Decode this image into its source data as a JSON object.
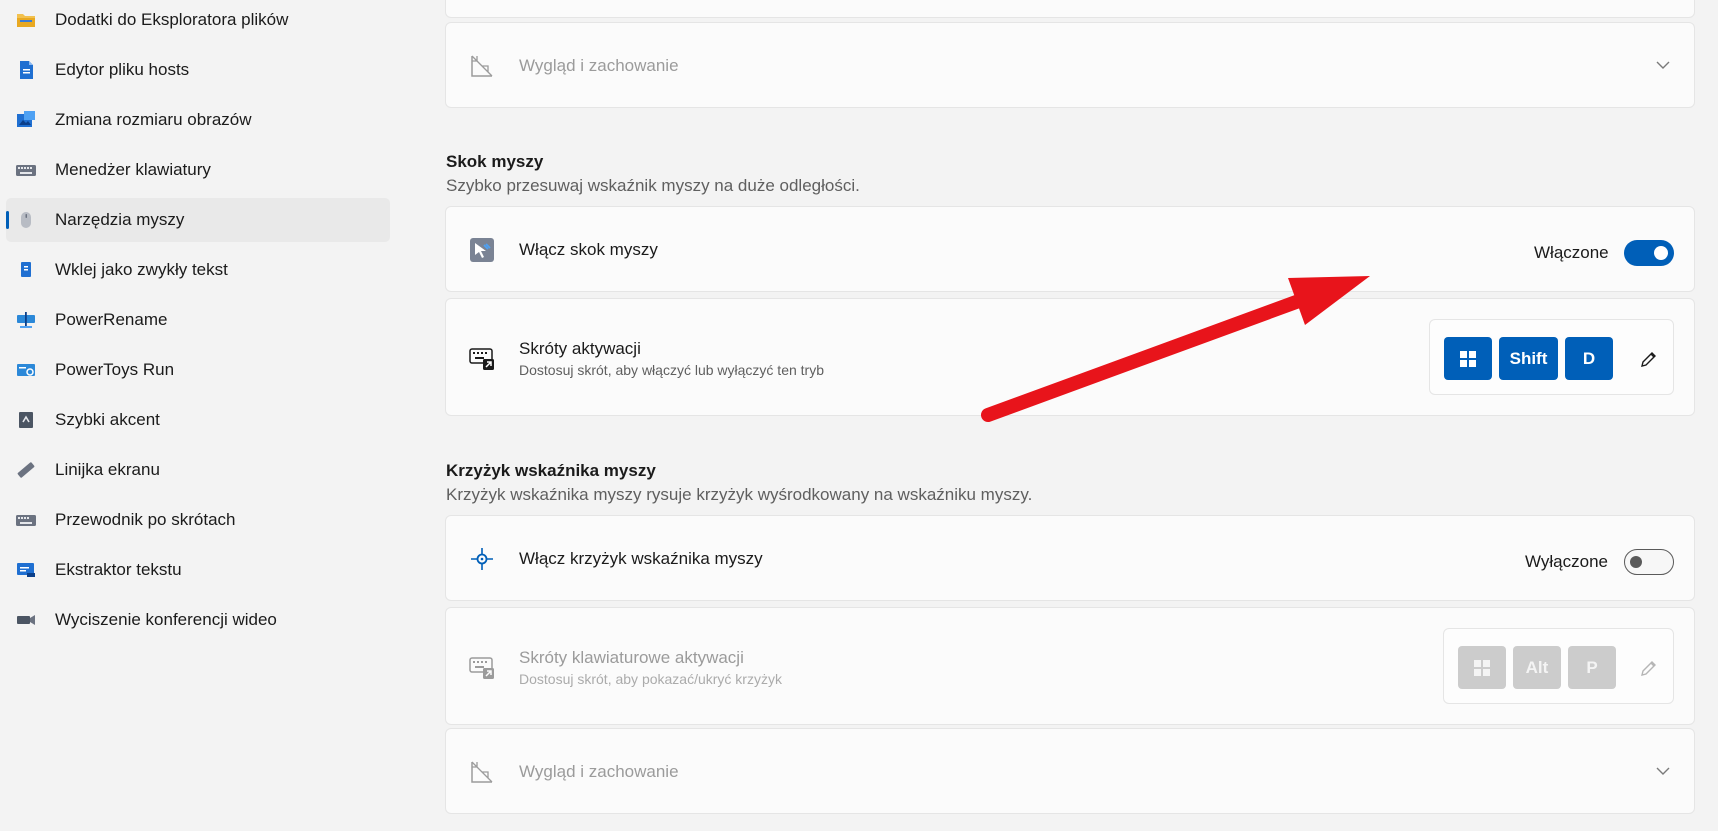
{
  "sidebar": {
    "items": [
      {
        "label": "Dodatki do Eksploratora plików",
        "icon": "folder-icon"
      },
      {
        "label": "Edytor pliku hosts",
        "icon": "document-icon"
      },
      {
        "label": "Zmiana rozmiaru obrazów",
        "icon": "image-resize-icon"
      },
      {
        "label": "Menedżer klawiatury",
        "icon": "keyboard-icon"
      },
      {
        "label": "Narzędzia myszy",
        "icon": "mouse-icon"
      },
      {
        "label": "Wklej jako zwykły tekst",
        "icon": "paste-icon"
      },
      {
        "label": "PowerRename",
        "icon": "rename-icon"
      },
      {
        "label": "PowerToys Run",
        "icon": "run-icon"
      },
      {
        "label": "Szybki akcent",
        "icon": "accent-icon"
      },
      {
        "label": "Linijka ekranu",
        "icon": "ruler-icon"
      },
      {
        "label": "Przewodnik po skrótach",
        "icon": "keyboard-guide-icon"
      },
      {
        "label": "Ekstraktor tekstu",
        "icon": "text-extractor-icon"
      },
      {
        "label": "Wyciszenie konferencji wideo",
        "icon": "camera-icon"
      }
    ],
    "selected": "Narzędzia myszy"
  },
  "main": {
    "top_appearance": {
      "label": "Wygląd i zachowanie"
    },
    "mouse_jump": {
      "title": "Skok myszy",
      "description": "Szybko przesuwaj wskaźnik myszy na duże odległości.",
      "enable": {
        "label": "Włącz skok myszy",
        "state_label": "Włączone",
        "on": true
      },
      "shortcut": {
        "title": "Skróty aktywacji",
        "description": "Dostosuj skrót, aby włączyć lub wyłączyć ten tryb",
        "keys": [
          "win",
          "Shift",
          "D"
        ]
      }
    },
    "crosshairs": {
      "title": "Krzyżyk wskaźnika myszy",
      "description": "Krzyżyk wskaźnika myszy rysuje krzyżyk wyśrodkowany na wskaźniku myszy.",
      "enable": {
        "label": "Włącz krzyżyk wskaźnika myszy",
        "state_label": "Wyłączone",
        "on": false
      },
      "shortcut": {
        "title": "Skróty klawiaturowe aktywacji",
        "description": "Dostosuj skrót, aby pokazać/ukryć krzyżyk",
        "keys": [
          "win",
          "Alt",
          "P"
        ]
      },
      "appearance": {
        "label": "Wygląd i zachowanie"
      }
    }
  },
  "colors": {
    "accent": "#005fb8",
    "annotation_arrow": "#e8141b"
  }
}
